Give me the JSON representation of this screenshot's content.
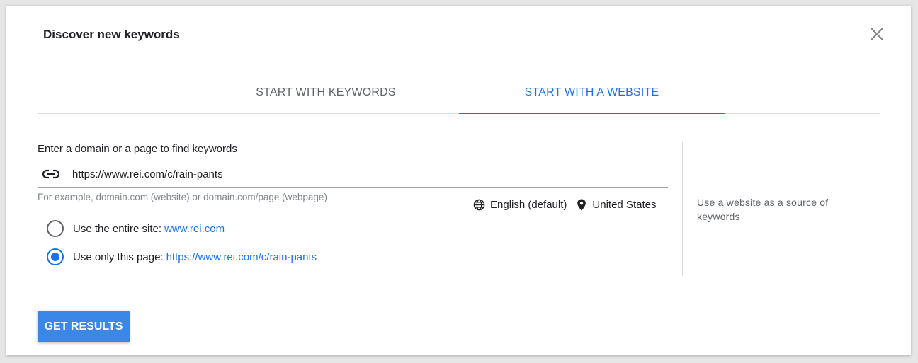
{
  "dialog": {
    "title": "Discover new keywords",
    "close_icon": "close-icon"
  },
  "tabs": [
    {
      "label": "START WITH KEYWORDS",
      "active": false
    },
    {
      "label": "START WITH A WEBSITE",
      "active": true
    }
  ],
  "website_form": {
    "prompt": "Enter a domain or a page to find keywords",
    "url_value": "https://www.rei.com/c/rain-pants",
    "url_icon": "link-icon",
    "hint": "For example, domain.com (website) or domain.com/page (webpage)",
    "language": "English (default)",
    "location": "United States",
    "options": [
      {
        "label": "Use the entire site:",
        "link": "www.rei.com",
        "selected": false
      },
      {
        "label": "Use only this page:",
        "link": "https://www.rei.com/c/rain-pants",
        "selected": true
      }
    ]
  },
  "side_panel": {
    "text": "Use a website as a source of keywords"
  },
  "actions": {
    "get_results_label": "GET RESULTS"
  },
  "colors": {
    "accent": "#1a73e8",
    "button": "#3b87e8",
    "text": "#202124",
    "muted": "#80868b"
  }
}
